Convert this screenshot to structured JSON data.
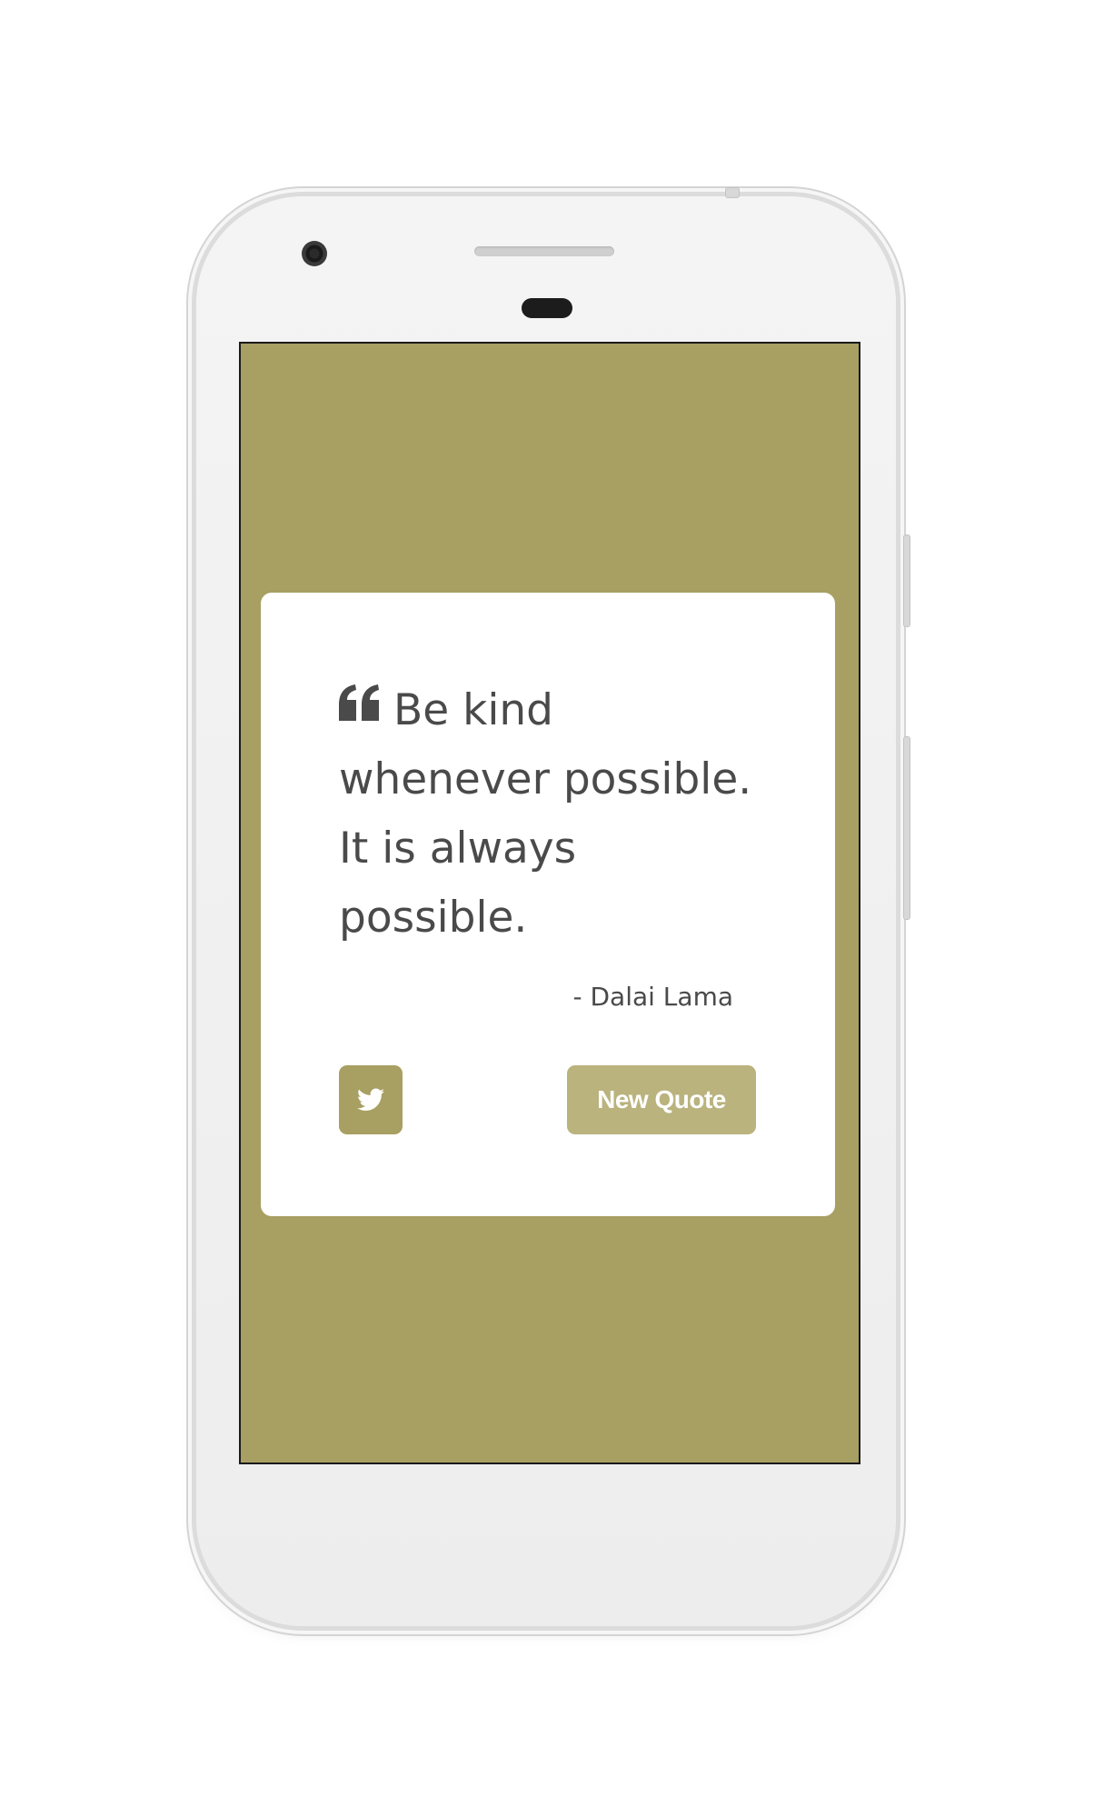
{
  "theme": {
    "background": "#a89f62",
    "accent": "#a89f62",
    "accent_light": "#bab37e",
    "text": "#4a4a4a"
  },
  "quote": {
    "icon": "quote-left-icon",
    "text": "Be kind whenever possible. It is always possible.",
    "author": "- Dalai Lama"
  },
  "actions": {
    "tweet_icon": "twitter-icon",
    "new_quote_label": "New Quote"
  }
}
